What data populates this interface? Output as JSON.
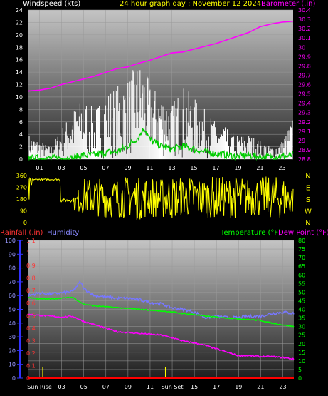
{
  "header": {
    "windspeed_label": "Windspeed (kts)",
    "title": "24 hour graph day : November 12 2024",
    "barometer_label": "Barometer (.in)"
  },
  "lower_header": {
    "rainfall_label": "Rainfall (.in)",
    "humidity_label": "Humidity",
    "temperature_label": "Temperature (°F)",
    "dewpoint_label": "Dew Point (°F)"
  },
  "colors": {
    "windspeed": "#ffffff",
    "wind_gust_avg": "#00cc00",
    "barometer": "#ff00ff",
    "wind_direction": "#ffff00",
    "rainfall": "#ff0000",
    "humidity": "#7777ff",
    "temperature": "#00ff00",
    "dewpoint": "#ff00ff",
    "title": "#ffff00"
  },
  "chart_data": [
    {
      "type": "line",
      "name": "wind-barometer",
      "x_ticks": [
        "01",
        "03",
        "05",
        "07",
        "09",
        "11",
        "13",
        "15",
        "17",
        "19",
        "21",
        "23"
      ],
      "y_left_ticks": [
        "0",
        "2",
        "4",
        "6",
        "8",
        "10",
        "12",
        "14",
        "16",
        "18",
        "20",
        "22",
        "24"
      ],
      "y_right_ticks": [
        "28.8",
        "28.9",
        "29",
        "29.1",
        "29.2",
        "29.3",
        "29.4",
        "29.5",
        "29.6",
        "29.7",
        "29.8",
        "29.9",
        "30",
        "30.1",
        "30.2",
        "30.3",
        "30.4"
      ],
      "ylim_left": [
        0,
        24
      ],
      "ylim_right": [
        28.8,
        30.4
      ],
      "xlim": [
        0,
        24
      ],
      "grid": true,
      "windspeed_envelope": {
        "x": [
          0,
          1,
          2,
          3,
          4,
          5,
          6,
          7,
          8,
          9,
          10,
          10.5,
          11,
          12,
          13,
          14,
          15,
          16,
          17,
          18,
          19,
          20,
          21,
          22,
          23,
          24
        ],
        "y": [
          4,
          3,
          2,
          5,
          8,
          10,
          8,
          11,
          12,
          13,
          16,
          15,
          12,
          11,
          9,
          12,
          10,
          8,
          6,
          5,
          4,
          4,
          3,
          2,
          3,
          7
        ]
      },
      "wind_avg": {
        "x": [
          0,
          2,
          4,
          5,
          6,
          7,
          8,
          9,
          10,
          10.5,
          11,
          12,
          13,
          14,
          15,
          16,
          17,
          18,
          19,
          20,
          21,
          22,
          23,
          24
        ],
        "y": [
          0,
          0,
          0,
          0.5,
          0.5,
          1,
          1,
          2,
          3.5,
          5,
          3,
          2,
          1.5,
          2,
          1.5,
          1,
          0.8,
          0.5,
          0.3,
          0.5,
          0.3,
          0.2,
          0.3,
          0.5
        ]
      },
      "barometer": {
        "x": [
          0,
          1,
          2,
          3,
          4,
          5,
          6,
          7,
          8,
          9,
          10,
          11,
          12,
          13,
          14,
          15,
          16,
          17,
          18,
          19,
          20,
          21,
          22,
          23,
          24
        ],
        "y": [
          29.53,
          29.54,
          29.56,
          29.6,
          29.63,
          29.66,
          29.69,
          29.73,
          29.77,
          29.79,
          29.83,
          29.86,
          29.9,
          29.94,
          29.95,
          29.98,
          30.01,
          30.04,
          30.08,
          30.12,
          30.16,
          30.22,
          30.25,
          30.27,
          30.28
        ]
      }
    },
    {
      "type": "line",
      "name": "wind-direction",
      "y_left_ticks": [
        "0",
        "90",
        "180",
        "270",
        "360"
      ],
      "y_right_ticks": [
        "N",
        "W",
        "S",
        "E",
        "N"
      ],
      "ylim": [
        0,
        360
      ],
      "xlim": [
        0,
        24
      ],
      "envelope": {
        "x": [
          0,
          0.5,
          1,
          2,
          3,
          3.5,
          4,
          5,
          6,
          7,
          8,
          9,
          10,
          11,
          12,
          13,
          14,
          15,
          16,
          17,
          18,
          19,
          20,
          21,
          22,
          23,
          24
        ],
        "hi": [
          350,
          340,
          340,
          340,
          200,
          180,
          180,
          340,
          350,
          340,
          340,
          360,
          350,
          360,
          340,
          360,
          350,
          360,
          340,
          360,
          350,
          360,
          340,
          360,
          350,
          360,
          300
        ],
        "lo": [
          100,
          300,
          300,
          300,
          180,
          120,
          90,
          60,
          50,
          40,
          30,
          40,
          20,
          40,
          30,
          20,
          50,
          30,
          40,
          30,
          40,
          30,
          50,
          40,
          30,
          20,
          60
        ]
      }
    },
    {
      "type": "line",
      "name": "rain-humidity-temperature",
      "x_ticks": [
        "Sun Rise",
        "03",
        "05",
        "07",
        "09",
        "11",
        "Sun Set",
        "15",
        "17",
        "19",
        "21",
        "23"
      ],
      "y_left_humidity_ticks": [
        "0",
        "10",
        "20",
        "30",
        "40",
        "50",
        "60",
        "70",
        "80",
        "90",
        "100"
      ],
      "y_left_rain_ticks": [
        "0",
        "0.1",
        "0.2",
        "0.3",
        "0.4",
        "0.5",
        "0.6",
        "0.7",
        "0.8",
        "0.9",
        "1",
        "1.1"
      ],
      "y_right_ticks": [
        "0",
        "5",
        "10",
        "15",
        "20",
        "25",
        "30",
        "35",
        "40",
        "45",
        "50",
        "55",
        "60",
        "65",
        "70",
        "75",
        "80"
      ],
      "ylim_humidity": [
        0,
        100
      ],
      "ylim_rain": [
        0,
        1.1
      ],
      "ylim_temp": [
        0,
        80
      ],
      "xlim": [
        0,
        24
      ],
      "grid": true,
      "sunrise_hour": 1.3,
      "sunset_hour": 12.4,
      "rainfall": {
        "x": [
          0,
          24
        ],
        "y": [
          0,
          0
        ]
      },
      "humidity": {
        "x": [
          0,
          1,
          2,
          3,
          4,
          4.7,
          5,
          6,
          7,
          8,
          9,
          10,
          11,
          12,
          13,
          14,
          15,
          16,
          17,
          18,
          19,
          20,
          21,
          22,
          23,
          24
        ],
        "y": [
          60,
          62,
          61,
          62,
          63,
          70,
          65,
          60,
          59,
          58,
          58,
          57,
          55,
          54,
          51,
          50,
          48,
          44,
          45,
          44,
          44,
          45,
          45,
          47,
          48,
          47
        ]
      },
      "temperature": {
        "x": [
          0,
          1,
          2,
          3,
          4,
          5,
          6,
          7,
          8,
          9,
          10,
          11,
          12,
          13,
          14,
          15,
          16,
          17,
          18,
          19,
          20,
          21,
          22,
          23,
          24
        ],
        "y": [
          47,
          46,
          46,
          46.5,
          47,
          43,
          42,
          41.5,
          41,
          40.5,
          40,
          39.5,
          39,
          38.5,
          37.5,
          37,
          36,
          35.5,
          35,
          34.5,
          34,
          33.5,
          32,
          31,
          30
        ]
      },
      "dewpoint": {
        "x": [
          0,
          1,
          2,
          3,
          4,
          5,
          6,
          7,
          8,
          9,
          10,
          11,
          12,
          13,
          14,
          15,
          16,
          17,
          18,
          19,
          20,
          21,
          22,
          23,
          24
        ],
        "y": [
          37,
          36.5,
          36,
          35.5,
          36,
          33,
          31,
          29,
          27,
          26.5,
          26,
          25.5,
          25,
          23.5,
          21.5,
          20.5,
          19,
          17,
          15,
          13,
          13,
          12.5,
          12.5,
          12,
          11
        ]
      }
    }
  ]
}
